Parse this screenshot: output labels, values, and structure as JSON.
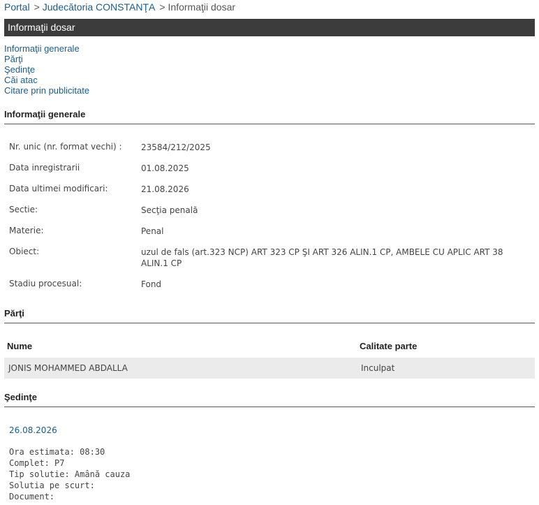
{
  "breadcrumb": {
    "portal": "Portal",
    "court": "Judecătoria CONSTANŢA",
    "current": "Informaţii dosar",
    "separator": ">"
  },
  "title": "Informaţii dosar",
  "nav": [
    "Informaţii generale",
    "Părţi",
    "Şedinţe",
    "Căi atac",
    "Citare prin publicitate"
  ],
  "general": {
    "heading": "Informaţii generale",
    "rows": [
      {
        "label": "Nr. unic (nr. format vechi) :",
        "value": "23584/212/2025"
      },
      {
        "label": "Data inregistrarii",
        "value": "01.08.2025"
      },
      {
        "label": "Data ultimei modificari:",
        "value": "21.08.2026"
      },
      {
        "label": "Sectie:",
        "value": "Secţia penală"
      },
      {
        "label": "Materie:",
        "value": "Penal"
      },
      {
        "label": "Obiect:",
        "value": "uzul de fals (art.323 NCP) ART 323 CP ŞI ART 326 ALIN.1 CP, AMBELE CU APLIC ART 38 ALIN.1 CP"
      },
      {
        "label": "Stadiu procesual:",
        "value": "Fond"
      }
    ]
  },
  "parti": {
    "heading": "Părţi",
    "col_name": "Nume",
    "col_role": "Calitate parte",
    "rows": [
      {
        "name": "JONIS MOHAMMED ABDALLA",
        "role": "Inculpat"
      }
    ]
  },
  "sedinte": {
    "heading": "Şedinţe",
    "date": "26.08.2026",
    "details": [
      "Ora estimata: 08:30",
      "Complet: P7",
      "Tip solutie: Amână cauza",
      "Solutia pe scurt:",
      "Document:"
    ]
  }
}
